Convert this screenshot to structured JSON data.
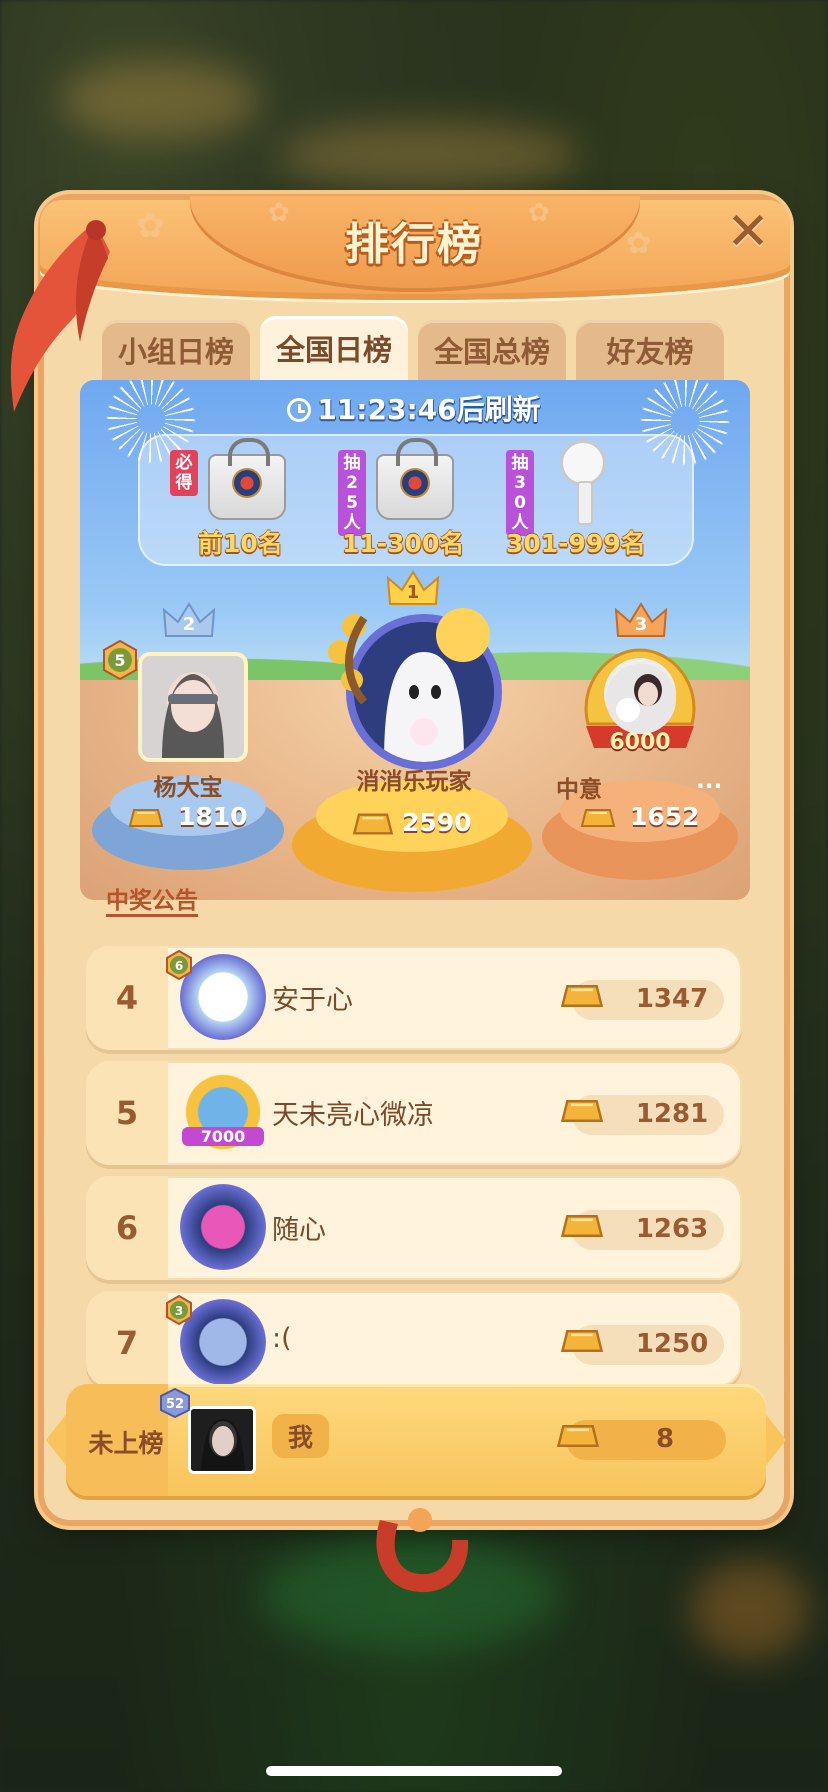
{
  "title": "排行榜",
  "tabs": [
    {
      "label": "小组日榜",
      "active": false
    },
    {
      "label": "全国日榜",
      "active": true
    },
    {
      "label": "全国总榜",
      "active": false
    },
    {
      "label": "好友榜",
      "active": false
    }
  ],
  "refresh_text": "11:23:46后刷新",
  "prizes": [
    {
      "tag": "必得",
      "label": "前10名",
      "item": "tote-bag"
    },
    {
      "tag": "抽25人",
      "label": "11-300名",
      "item": "tote-bag"
    },
    {
      "tag": "抽30人",
      "label": "301-999名",
      "item": "hand-fan"
    }
  ],
  "podium": [
    {
      "rank": "2",
      "name": "杨大宝",
      "score": "1810",
      "level": "5"
    },
    {
      "rank": "1",
      "name": "消消乐玩家",
      "score": "2590"
    },
    {
      "rank": "3",
      "name": "中意",
      "name_suffix": "...",
      "score": "1652",
      "frame_text": "6000"
    }
  ],
  "notice": "中奖公告",
  "list": [
    {
      "rank": "4",
      "name": "安于心",
      "score": "1347",
      "level": "6"
    },
    {
      "rank": "5",
      "name": "天未亮心微凉",
      "score": "1281",
      "frame_text": "7000"
    },
    {
      "rank": "6",
      "name": "随心",
      "score": "1263"
    },
    {
      "rank": "7",
      "name": ":(",
      "score": "1250",
      "level": "3"
    }
  ],
  "me": {
    "status": "未上榜",
    "name": "我",
    "score": "8",
    "level": "52"
  },
  "colors": {
    "panel": "#f6d9a8",
    "header": "#f3a456",
    "accent_text": "#8a4d28",
    "gold": "#f4b43a"
  }
}
